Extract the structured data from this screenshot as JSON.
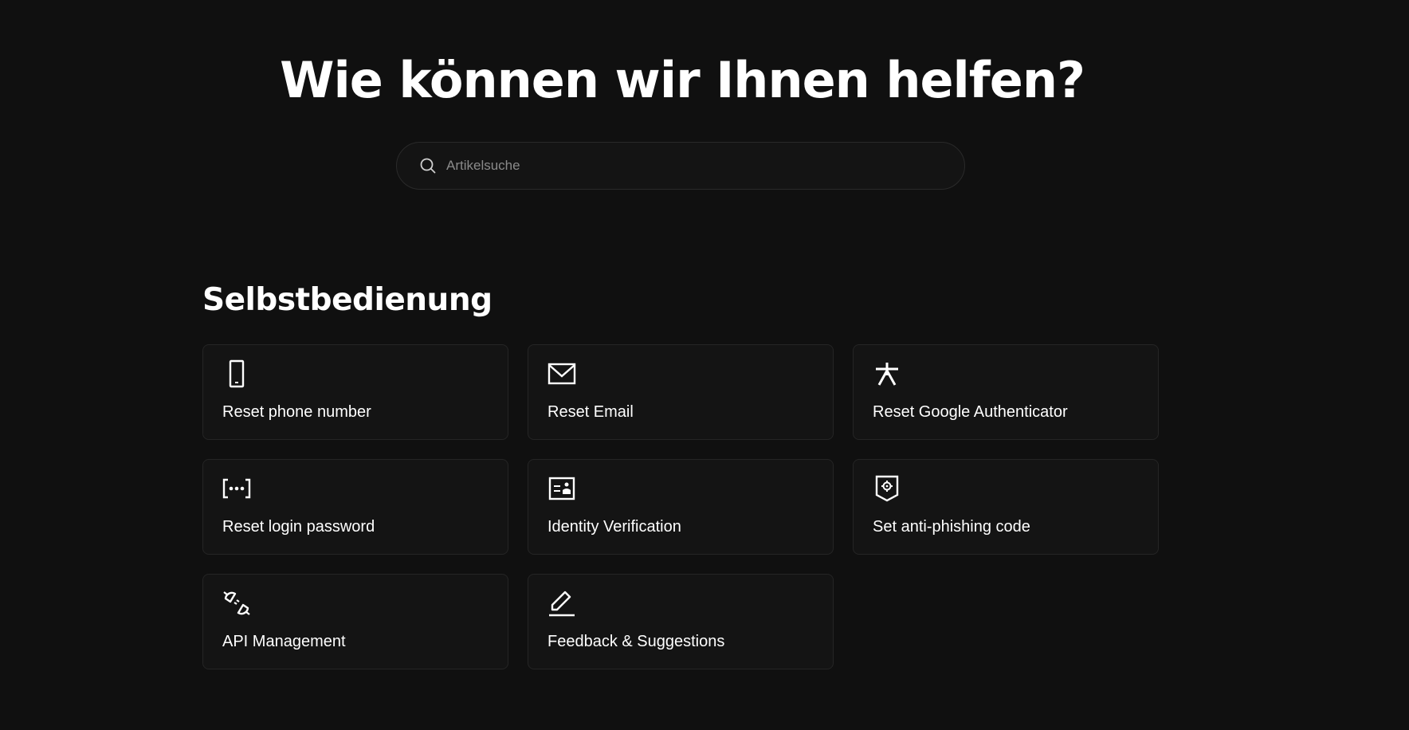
{
  "hero": {
    "title": "Wie können wir Ihnen helfen?"
  },
  "search": {
    "placeholder": "Artikelsuche",
    "icon": "search-icon"
  },
  "self_service": {
    "title": "Selbstbedienung",
    "items": [
      {
        "label": "Reset phone number",
        "icon": "phone-icon"
      },
      {
        "label": "Reset Email",
        "icon": "envelope-icon"
      },
      {
        "label": "Reset Google Authenticator",
        "icon": "asterisk-icon"
      },
      {
        "label": "Reset login password",
        "icon": "password-dots-icon"
      },
      {
        "label": "Identity Verification",
        "icon": "id-card-icon"
      },
      {
        "label": "Set anti-phishing code",
        "icon": "shield-gear-icon"
      },
      {
        "label": "API Management",
        "icon": "plug-disconnect-icon"
      },
      {
        "label": "Feedback & Suggestions",
        "icon": "pencil-icon"
      }
    ]
  },
  "colors": {
    "background": "#101010",
    "card_background": "#141414",
    "card_border": "#252525",
    "text": "#ffffff",
    "placeholder": "#8a8a8a"
  }
}
